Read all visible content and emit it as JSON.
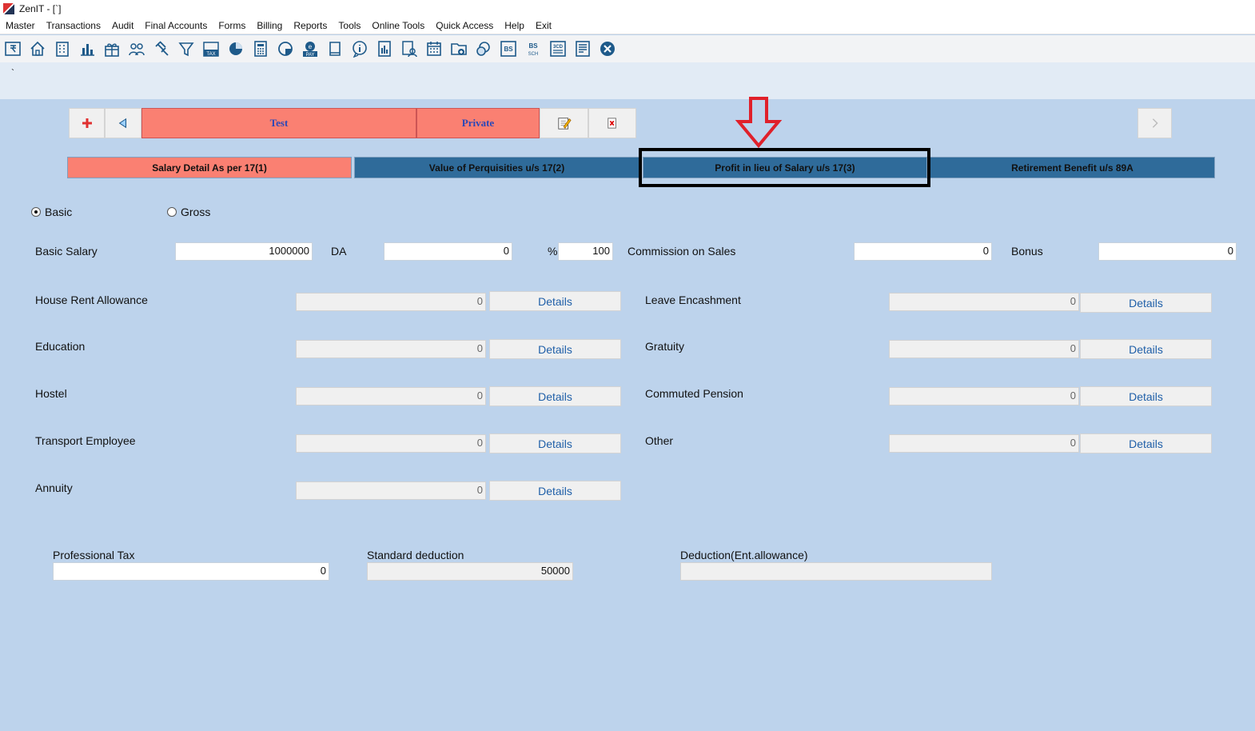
{
  "app": {
    "title": "ZenIT - [`]"
  },
  "menu": [
    "Master",
    "Transactions",
    "Audit",
    "Final Accounts",
    "Forms",
    "Billing",
    "Reports",
    "Tools",
    "Online Tools",
    "Quick Access",
    "Help",
    "Exit"
  ],
  "toolbar_icons": [
    "rupee-book-icon",
    "home-icon",
    "building-icon",
    "bar-chart-icon",
    "gift-icon",
    "users-icon",
    "gavel-icon",
    "filter-icon",
    "tax-icon",
    "pie-circle-icon",
    "calculator-icon",
    "chart-round-icon",
    "epay-icon",
    "book-icon",
    "info-icon",
    "report-icon",
    "user-edit-icon",
    "calendar-icon",
    "folder-add-icon",
    "chat-icon",
    "bs-icon",
    "bs-sch-icon",
    "3cd-icon",
    "form-icon",
    "close-icon"
  ],
  "toolbar_text": {
    "tax": "TAX",
    "pay": "PAY",
    "bs": "BS",
    "sch": "SCH",
    "cd": "3CD"
  },
  "strip": {
    "mark": "`"
  },
  "record": {
    "name": "Test",
    "type": "Private"
  },
  "tabs": [
    {
      "label": "Salary Detail As per 17(1)",
      "active": true
    },
    {
      "label": "Value of Perquisities u/s 17(2)",
      "active": false
    },
    {
      "label": "Profit in lieu of Salary u/s 17(3)",
      "active": false
    },
    {
      "label": "Retirement Benefit u/s 89A",
      "active": false
    }
  ],
  "salary_mode": {
    "options": [
      "Basic",
      "Gross"
    ],
    "selected": "Basic"
  },
  "row1": {
    "basic_salary_label": "Basic Salary",
    "basic_salary": "1000000",
    "da_label": "DA",
    "da": "0",
    "pct_label": "%",
    "pct": "100",
    "commission_label": "Commission on Sales",
    "commission": "0",
    "bonus_label": "Bonus",
    "bonus": "0"
  },
  "details_label": "Details",
  "left_fields": [
    {
      "label": "House Rent Allowance",
      "value": "0"
    },
    {
      "label": "Education",
      "value": "0"
    },
    {
      "label": "Hostel",
      "value": "0"
    },
    {
      "label": "Transport Employee",
      "value": "0"
    },
    {
      "label": "Annuity",
      "value": "0"
    }
  ],
  "right_fields": [
    {
      "label": "Leave Encashment",
      "value": "0"
    },
    {
      "label": "Gratuity",
      "value": "0"
    },
    {
      "label": "Commuted Pension",
      "value": "0"
    },
    {
      "label": "Other",
      "value": "0"
    }
  ],
  "deductions": {
    "professional_tax_label": "Professional Tax",
    "professional_tax": "0",
    "standard_deduction_label": "Standard deduction",
    "standard_deduction": "50000",
    "ent_allowance_label": "Deduction(Ent.allowance)",
    "ent_allowance": ""
  },
  "colors": {
    "active_tab": "#fa8072",
    "inactive_tab": "#2f6b9a",
    "background": "#bdd3ec",
    "highlight_arrow": "#e0202a"
  }
}
